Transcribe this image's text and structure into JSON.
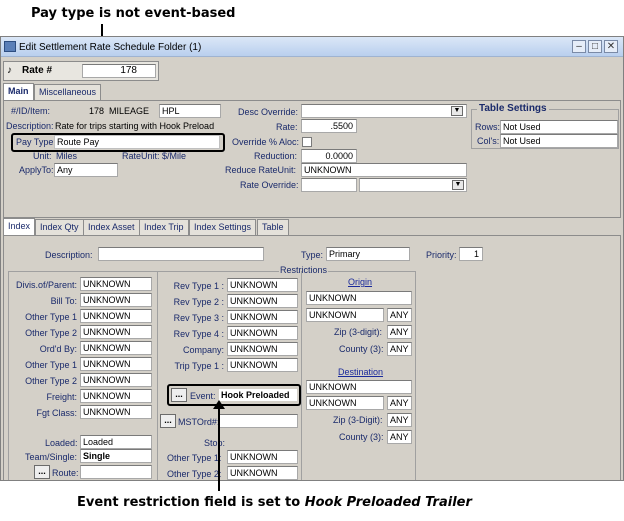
{
  "callouts": {
    "top": "Pay type is not event-based",
    "bottom_prefix": "Event restriction field is set to ",
    "bottom_italic": "Hook Preloaded Trailer"
  },
  "window": {
    "title": "Edit Settlement Rate Schedule Folder (1)",
    "minimize": "–",
    "maximize": "□",
    "close": "✕"
  },
  "header": {
    "rate_label": "Rate #",
    "rate_value": "178"
  },
  "top_tabs": [
    "Main",
    "Miscellaneous"
  ],
  "main": {
    "id_item_label": "#/ID/Item:",
    "id_value": "178",
    "id_code": "MILEAGE",
    "item": "HPL",
    "description_label": "Description:",
    "description_value": "Rate for trips starting with Hook Preload",
    "pay_type_label": "Pay Type",
    "pay_type_value": "Route Pay",
    "unit_label": "Unit:",
    "unit_value": "Miles",
    "rate_unit_label": "RateUnit:",
    "rate_unit_value": "$/Mile",
    "apply_to_label": "ApplyTo:",
    "apply_to_value": "Any",
    "desc_override_label": "Desc Override:",
    "desc_override_value": "",
    "rate_label": "Rate:",
    "rate_value": ".5500",
    "override_alloc_label": "Override % Aloc:",
    "reduction_label": "Reduction:",
    "reduction_value": "0.0000",
    "reduce_rate_unit_label": "Reduce RateUnit:",
    "reduce_rate_unit_value": "UNKNOWN",
    "rate_override_label": "Rate Override:",
    "rate_override_value": ""
  },
  "table_settings": {
    "title": "Table Settings",
    "rows_label": "Rows:",
    "rows_value": "Not Used",
    "cols_label": "Col's:",
    "cols_value": "Not Used"
  },
  "lower_tabs": [
    "Index",
    "Index Qty",
    "Index Asset",
    "Index Trip",
    "Index Settings",
    "Table"
  ],
  "index": {
    "description_label": "Description:",
    "description_value": "",
    "type_label": "Type:",
    "type_value": "Primary",
    "priority_label": "Priority:",
    "priority_value": "1",
    "restrictions_label": "Restrictions"
  },
  "left_col": [
    {
      "label": "Divis.of/Parent:",
      "value": "UNKNOWN"
    },
    {
      "label": "Bill To:",
      "value": "UNKNOWN"
    },
    {
      "label": "Other Type 1",
      "value": "UNKNOWN"
    },
    {
      "label": "Other Type 2",
      "value": "UNKNOWN"
    },
    {
      "label": "Ord'd By:",
      "value": "UNKNOWN"
    },
    {
      "label": "Other Type 1",
      "value": "UNKNOWN"
    },
    {
      "label": "Other Type 2",
      "value": "UNKNOWN"
    },
    {
      "label": "Freight:",
      "value": "UNKNOWN"
    },
    {
      "label": "Fgt Class:",
      "value": "UNKNOWN"
    }
  ],
  "left_bottom": {
    "loaded_label": "Loaded:",
    "loaded_value": "Loaded",
    "team_label": "Team/Single:",
    "team_value": "Single",
    "route_btn": "...",
    "route_label": "Route:",
    "route_value": ""
  },
  "mid_col": [
    {
      "label": "Rev Type 1 :",
      "value": "UNKNOWN"
    },
    {
      "label": "Rev Type 2 :",
      "value": "UNKNOWN"
    },
    {
      "label": "Rev Type 3 :",
      "value": "UNKNOWN"
    },
    {
      "label": "Rev Type 4 :",
      "value": "UNKNOWN"
    },
    {
      "label": "Company:",
      "value": "UNKNOWN"
    },
    {
      "label": "Trip Type 1 :",
      "value": "UNKNOWN"
    }
  ],
  "mid_bottom": {
    "event_btn": "...",
    "event_label": "Event:",
    "event_value": "Hook Preloaded",
    "mstord_btn": "...",
    "mstord_label": "MSTOrd#:",
    "mstord_value": "",
    "stop_label": "Stop:",
    "stop_other1_label": "Other Type 1:",
    "stop_other1_value": "UNKNOWN",
    "stop_other2_label": "Other Type 2:",
    "stop_other2_value": "UNKNOWN"
  },
  "origin": {
    "title": "Origin",
    "value": "UNKNOWN",
    "value2": "UNKNOWN",
    "any1": "ANY",
    "zip_label": "Zip (3-digit):",
    "zip_value": "ANY",
    "county_label": "County (3):",
    "county_value": "ANY"
  },
  "destination": {
    "title": "Destination",
    "value": "UNKNOWN",
    "value2": "UNKNOWN",
    "any1": "ANY",
    "zip_label": "Zip (3-Digit):",
    "zip_value": "ANY",
    "county_label": "County (3):",
    "county_value": "ANY"
  }
}
